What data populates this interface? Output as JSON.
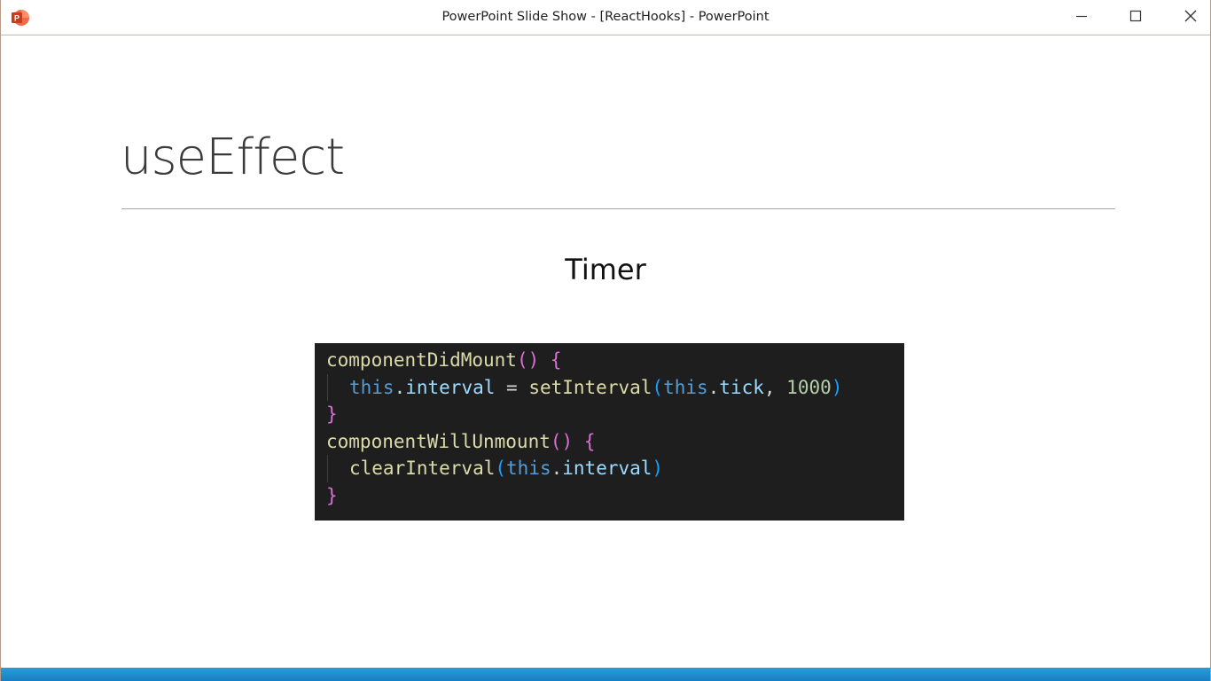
{
  "window": {
    "title": "PowerPoint Slide Show - [ReactHooks] - PowerPoint",
    "app_icon": "powerpoint-icon",
    "controls": {
      "minimize_icon": "minimize-icon",
      "maximize_icon": "maximize-icon",
      "close_icon": "close-icon"
    }
  },
  "slide": {
    "title": "useEffect",
    "subtitle": "Timer",
    "code": {
      "line1": {
        "fn": "componentDidMount",
        "paren": "()",
        "brace": "{"
      },
      "line2": {
        "kw_this": "this",
        "dot": ".",
        "prop": "interval",
        "eq": " = ",
        "fn": "setInterval",
        "open_paren": "(",
        "kw_this2": "this",
        "dot2": ".",
        "prop2": "tick",
        "comma": ", ",
        "num": "1000",
        "close_paren": ")"
      },
      "line3": {
        "brace": "}"
      },
      "line4": {
        "fn": "componentWillUnmount",
        "paren": "()",
        "brace": "{"
      },
      "line5": {
        "fn": "clearInterval",
        "open_paren": "(",
        "kw_this": "this",
        "dot": ".",
        "prop": "interval",
        "close_paren": ")"
      },
      "line6": {
        "brace": "}"
      }
    }
  },
  "colors": {
    "status_bar": "#1680c4",
    "code_background": "#1e1e1e",
    "accent_powerpoint": "#d04423"
  }
}
